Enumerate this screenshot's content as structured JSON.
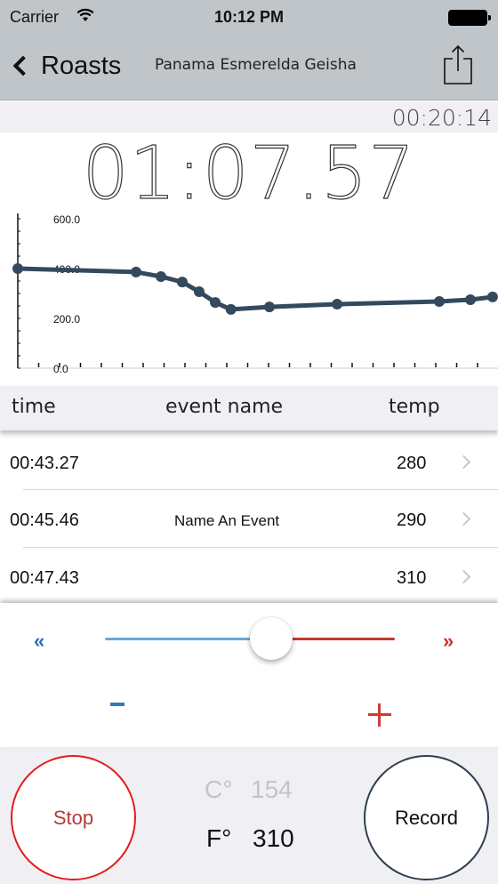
{
  "status_bar": {
    "carrier": "Carrier",
    "time": "10:12 PM"
  },
  "nav": {
    "back_label": "Roasts",
    "title": "Panama Esmerelda Geisha",
    "share_icon": "share-icon"
  },
  "timers": {
    "total": "00:20:14",
    "current": "01:07.57"
  },
  "chart_data": {
    "type": "line",
    "title": "",
    "xlabel": "",
    "ylabel": "",
    "y_tick_labels": [
      "0.0",
      "200.0",
      "400.0",
      "600.0"
    ],
    "ylim": [
      0,
      600
    ],
    "x_ticks_count": 23,
    "x": [
      0,
      5.66,
      6.85,
      7.87,
      8.68,
      9.45,
      10.2,
      12.04,
      15.28,
      20.17,
      21.66,
      22.72
    ],
    "values": [
      400,
      386,
      368,
      346,
      307,
      264,
      236,
      246,
      257,
      268,
      275,
      286
    ],
    "series_color": "#34495e",
    "grid": false,
    "legend": "none"
  },
  "table": {
    "headers": {
      "time": "time",
      "event": "event name",
      "temp": "temp"
    },
    "rows": [
      {
        "time": "00:43.27",
        "event": "",
        "temp": "280"
      },
      {
        "time": "00:45.46",
        "event": "Name An Event",
        "temp": "290"
      },
      {
        "time": "00:47.43",
        "event": "",
        "temp": "310"
      }
    ]
  },
  "controls": {
    "rewind_label": "«",
    "forward_label": "»",
    "slider_value_fraction": 0.56,
    "minus_label": "-",
    "plus_label": "+"
  },
  "bottom": {
    "stop_label": "Stop",
    "record_label": "Record",
    "celsius_unit": "C°",
    "celsius_value": "154",
    "fahrenheit_unit": "F°",
    "fahrenheit_value": "310"
  }
}
